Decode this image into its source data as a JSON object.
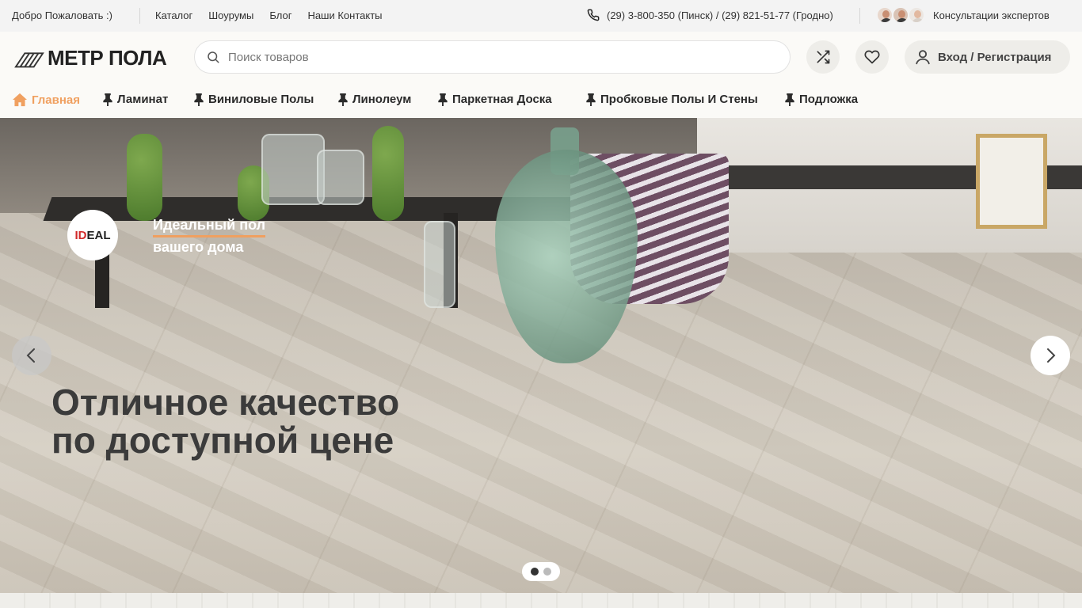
{
  "topbar": {
    "welcome": "Добро Пожаловать :)",
    "links": [
      "Каталог",
      "Шоурумы",
      "Блог",
      "Наши Контакты"
    ],
    "phone": "(29) 3-800-350 (Пинск) / (29) 821-51-77 (Гродно)",
    "experts_label": "Консультации экспертов"
  },
  "header": {
    "logo_text": "МЕТР ПОЛА",
    "search_placeholder": "Поиск товаров",
    "login_label": "Вход / Регистрация"
  },
  "nav": {
    "items": [
      {
        "label": "Главная",
        "active": true
      },
      {
        "label": "Ламинат"
      },
      {
        "label": "Виниловые Полы"
      },
      {
        "label": "Линолеум"
      },
      {
        "label": "Паркетная Доска"
      },
      {
        "label": "Пробковые Полы И Стены"
      },
      {
        "label": "Подложка"
      }
    ]
  },
  "hero": {
    "brand_logo": {
      "part1": "ID",
      "part2": "EAL"
    },
    "tagline_line1": "Идеальный пол",
    "tagline_line2": "вашего дома",
    "headline_line1": "Отличное качество",
    "headline_line2": "по доступной цене",
    "slides_count": 2,
    "active_slide": 1
  },
  "colors": {
    "accent": "#f0a060",
    "topbar_bg": "#f3f3f3",
    "header_bg": "#fbfaf7",
    "button_bg": "#eeede9",
    "brand_red": "#d12a2a"
  },
  "icons": {
    "phone": "phone-icon",
    "search": "search-icon",
    "compare": "shuffle-icon",
    "wishlist": "heart-icon",
    "user": "user-icon",
    "home": "home-icon",
    "pin": "pin-icon",
    "prev": "chevron-left-icon",
    "next": "chevron-right-icon"
  }
}
